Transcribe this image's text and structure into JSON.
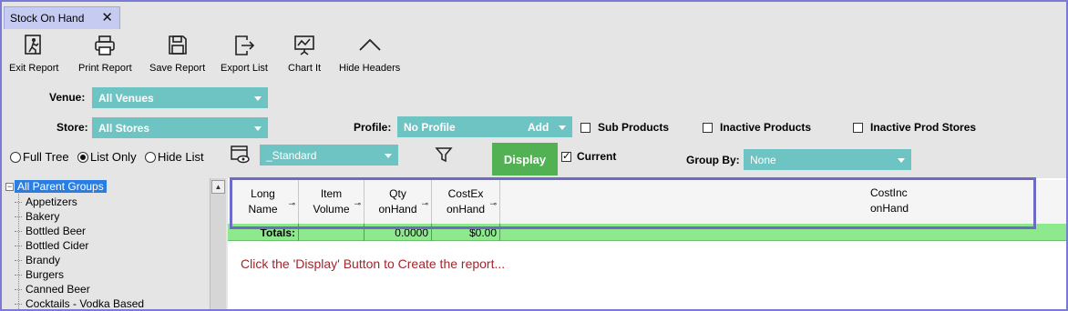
{
  "tab": {
    "title": "Stock On Hand",
    "close": "✕"
  },
  "toolbar": [
    {
      "label": "Exit Report",
      "icon": "exit-icon"
    },
    {
      "label": "Print Report",
      "icon": "printer-icon"
    },
    {
      "label": "Save Report",
      "icon": "save-icon"
    },
    {
      "label": "Export List",
      "icon": "export-icon"
    },
    {
      "label": "Chart It",
      "icon": "chart-icon"
    },
    {
      "label": "Hide Headers",
      "icon": "chevron-up-icon"
    }
  ],
  "filters": {
    "venue_label": "Venue:",
    "venue_value": "All Venues",
    "store_label": "Store:",
    "store_value": "All Stores",
    "profile_label": "Profile:",
    "profile_value": "No Profile",
    "profile_add": "Add",
    "sub_products": "Sub Products",
    "inactive_products": "Inactive Products",
    "inactive_prod_stores": "Inactive Prod Stores",
    "layout_value": "_Standard",
    "display": "Display",
    "current": "Current",
    "group_by_label": "Group By:",
    "group_by_value": "None"
  },
  "view_mode": {
    "options": [
      "Full Tree",
      "List Only",
      "Hide List"
    ],
    "selected": "List Only"
  },
  "tree": {
    "root": "All Parent Groups",
    "items": [
      "Appetizers",
      "Bakery",
      "Bottled Beer",
      "Bottled Cider",
      "Brandy",
      "Burgers",
      "Canned Beer",
      "Cocktails - Vodka Based"
    ]
  },
  "grid": {
    "columns": [
      {
        "line1": "Long",
        "line2": "Name"
      },
      {
        "line1": "Item",
        "line2": "Volume"
      },
      {
        "line1": "Qty",
        "line2": "onHand"
      },
      {
        "line1": "CostEx",
        "line2": "onHand"
      },
      {
        "line1": "CostInc",
        "line2": "onHand"
      }
    ],
    "totals_label": "Totals:",
    "totals": {
      "qty": "0.0000",
      "costex": "$0.00"
    },
    "message": "Click the 'Display' Button to Create the report..."
  },
  "colors": {
    "accent_teal": "#6ec3c3",
    "display_green": "#52b152",
    "totals_green": "#8ee88e",
    "message_red": "#a1262d",
    "highlight": "#6c6cc8"
  }
}
